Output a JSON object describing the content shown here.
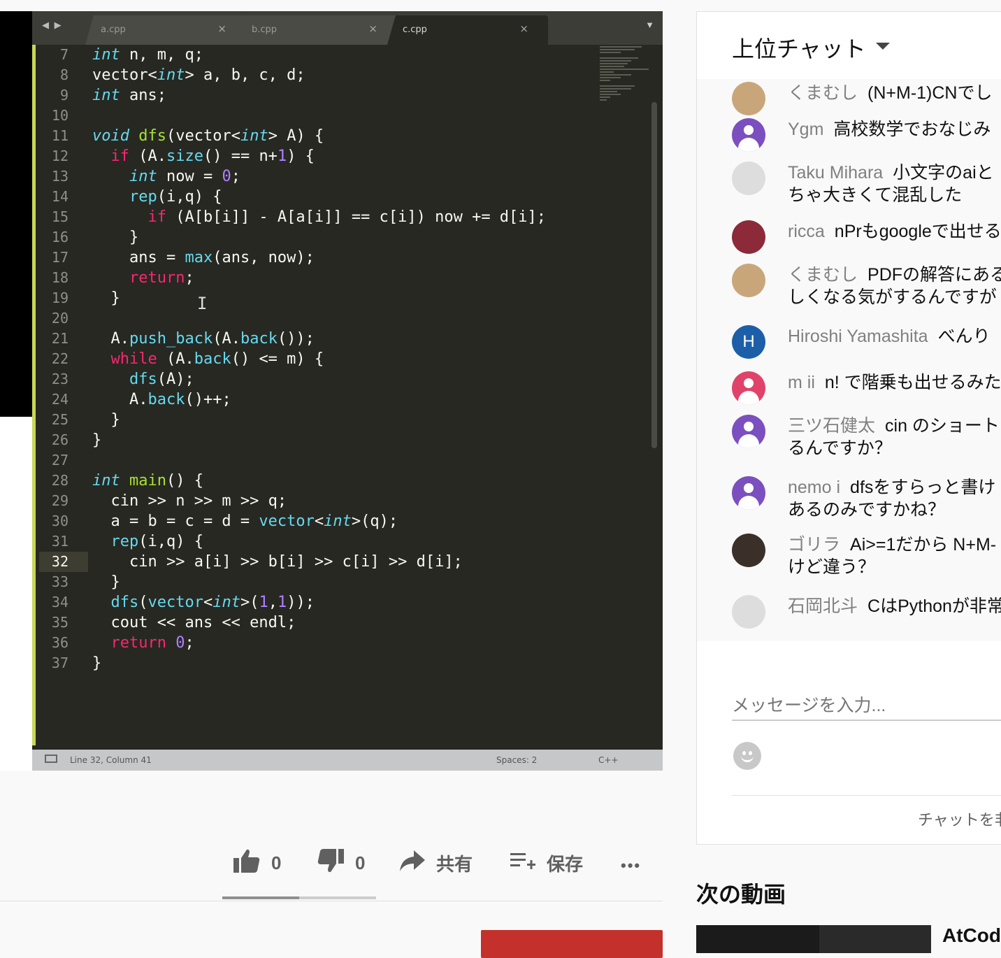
{
  "editor": {
    "tabs": [
      {
        "label": "a.cpp",
        "close": "×"
      },
      {
        "label": "b.cpp",
        "close": "×"
      },
      {
        "label": "c.cpp",
        "close": "×"
      }
    ],
    "tab_nav": "◀ ▶",
    "tab_menu": "▼",
    "current_line": 32,
    "lines": [
      {
        "n": "7",
        "html": "<span class='k-type'>int</span> n, m, q;"
      },
      {
        "n": "8",
        "html": "vector&lt;<span class='k-type'>int</span>&gt; a, b, c, d;"
      },
      {
        "n": "9",
        "html": "<span class='k-type'>int</span> ans;"
      },
      {
        "n": "10",
        "html": ""
      },
      {
        "n": "11",
        "html": "<span class='k-type'>void</span> <span class='k-fn'>dfs</span>(vector&lt;<span class='k-type'>int</span>&gt; A) {"
      },
      {
        "n": "12",
        "html": "  <span class='k-ctrl'>if</span> (A.<span class='k-call'>size</span>() == n+<span class='num'>1</span>) {"
      },
      {
        "n": "13",
        "html": "    <span class='k-type'>int</span> now = <span class='num'>0</span>;"
      },
      {
        "n": "14",
        "html": "    <span class='k-call'>rep</span>(i,q) {"
      },
      {
        "n": "15",
        "html": "      <span class='k-ctrl'>if</span> (A[b[i]] - A[a[i]] == c[i]) now += d[i];"
      },
      {
        "n": "16",
        "html": "    }"
      },
      {
        "n": "17",
        "html": "    ans = <span class='k-call'>max</span>(ans, now);"
      },
      {
        "n": "18",
        "html": "    <span class='k-ctrl'>return</span>;"
      },
      {
        "n": "19",
        "html": "  }"
      },
      {
        "n": "20",
        "html": ""
      },
      {
        "n": "21",
        "html": "  A.<span class='k-call'>push_back</span>(A.<span class='k-call'>back</span>());"
      },
      {
        "n": "22",
        "html": "  <span class='k-ctrl'>while</span> (A.<span class='k-call'>back</span>() &lt;= m) {"
      },
      {
        "n": "23",
        "html": "    <span class='k-call'>dfs</span>(A);"
      },
      {
        "n": "24",
        "html": "    A.<span class='k-call'>back</span>()++;"
      },
      {
        "n": "25",
        "html": "  }"
      },
      {
        "n": "26",
        "html": "}"
      },
      {
        "n": "27",
        "html": ""
      },
      {
        "n": "28",
        "html": "<span class='k-type'>int</span> <span class='k-fn'>main</span>() {"
      },
      {
        "n": "29",
        "html": "  cin &gt;&gt; n &gt;&gt; m &gt;&gt; q;"
      },
      {
        "n": "30",
        "html": "  a = b = c = d = <span class='k-call'>vector</span>&lt;<span class='k-type'>int</span>&gt;(q);"
      },
      {
        "n": "31",
        "html": "  <span class='k-call'>rep</span>(i,q) {"
      },
      {
        "n": "32",
        "html": "    cin &gt;&gt; a[i] &gt;&gt; b[i] &gt;&gt; c[i] &gt;&gt; d[i];"
      },
      {
        "n": "33",
        "html": "  }"
      },
      {
        "n": "34",
        "html": "  <span class='k-call'>dfs</span>(<span class='k-call'>vector</span>&lt;<span class='k-type'>int</span>&gt;(<span class='num'>1</span>,<span class='num'>1</span>));"
      },
      {
        "n": "35",
        "html": "  cout &lt;&lt; ans &lt;&lt; endl;"
      },
      {
        "n": "36",
        "html": "  <span class='k-ctrl'>return</span> <span class='num'>0</span>;"
      },
      {
        "n": "37",
        "html": "}"
      }
    ],
    "status": {
      "position": "Line 32, Column 41",
      "spaces": "Spaces: 2",
      "syntax": "C++"
    }
  },
  "actions": {
    "like_count": "0",
    "dislike_count": "0",
    "share_label": "共有",
    "save_label": "保存",
    "more": "•••",
    "like_ratio": 0.5
  },
  "chat": {
    "title": "上位チャット",
    "messages": [
      {
        "author": "くまむし",
        "text": "(N+M-1)CNでし",
        "avatar": "tan"
      },
      {
        "author": "Ygm",
        "text": "高校数学でおなじみ",
        "avatar": "purple"
      },
      {
        "author": "Taku Mihara",
        "text": "小文字のaiと",
        "text2": "ちゃ大きくて混乱した",
        "avatar": "bw"
      },
      {
        "author": "ricca",
        "text": "nPrもgoogleで出せる",
        "avatar": "red"
      },
      {
        "author": "くまむし",
        "text": "PDFの解答にある",
        "text2": "しくなる気がするんですが",
        "avatar": "tan"
      },
      {
        "author": "Hiroshi Yamashita",
        "text": "べんり",
        "avatar": "blue",
        "initial": "H"
      },
      {
        "author": "m ii",
        "text": "n! で階乗も出せるみた",
        "avatar": "pink"
      },
      {
        "author": "三ツ石健太",
        "text": "cin のショート",
        "text2": "るんですか？",
        "avatar": "purple"
      },
      {
        "author": "nemo i",
        "text": "dfsをすらっと書け",
        "text2": "あるのみですかね？",
        "avatar": "purple"
      },
      {
        "author": "ゴリラ",
        "text": "Ai>=1だから N+M-",
        "text2": "けど違う？",
        "avatar": "dark"
      },
      {
        "author": "石岡北斗",
        "text": "CはPythonが非常",
        "avatar": "bw"
      }
    ],
    "input_placeholder": "メッセージを入力...",
    "footer_link": "チャットを非"
  },
  "sidebar": {
    "next_title": "次の動画",
    "next_video_title": "AtCode"
  }
}
